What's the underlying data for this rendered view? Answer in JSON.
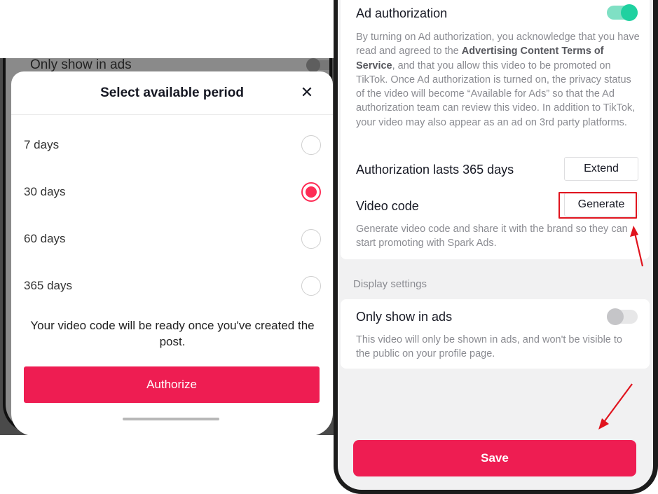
{
  "left_panel": {
    "background_row": {
      "label": "Only show in ads"
    },
    "sheet": {
      "title": "Select available period",
      "close_icon": "close-icon",
      "options": [
        {
          "label": "7 days",
          "selected": false
        },
        {
          "label": "30 days",
          "selected": true
        },
        {
          "label": "60 days",
          "selected": false
        },
        {
          "label": "365 days",
          "selected": false
        }
      ],
      "note": "Your video code will be ready once you've created the post.",
      "authorize_label": "Authorize"
    }
  },
  "right_panel": {
    "ad_authorization": {
      "title": "Ad authorization",
      "toggle_on": true,
      "desc_part1": "By turning on Ad authorization, you acknowledge that you have read and agreed to the ",
      "desc_link": "Advertising Content Terms of Service",
      "desc_part2": ", and that you allow this video to be promoted on TikTok. Once Ad authorization is turned on, the privacy status of the video will become “Available for Ads” so that the Ad authorization team can review this video. In addition to TikTok, your video may also appear as an ad on 3rd party platforms."
    },
    "authorization": {
      "label": "Authorization lasts 365 days",
      "extend_label": "Extend"
    },
    "video_code": {
      "label": "Video code",
      "generate_label": "Generate",
      "desc": "Generate video code and share it with the brand so they can start promoting with Spark Ads."
    },
    "display_settings": {
      "section_label": "Display settings",
      "only_ads_label": "Only show in ads",
      "toggle_on": false,
      "only_ads_desc": "This video will only be shown in ads, and won't be visible to the public on your profile page."
    },
    "save_label": "Save"
  },
  "colors": {
    "accent": "#ee1d52",
    "toggle_on": "#1fd1a0",
    "annotation": "#e0141e"
  }
}
